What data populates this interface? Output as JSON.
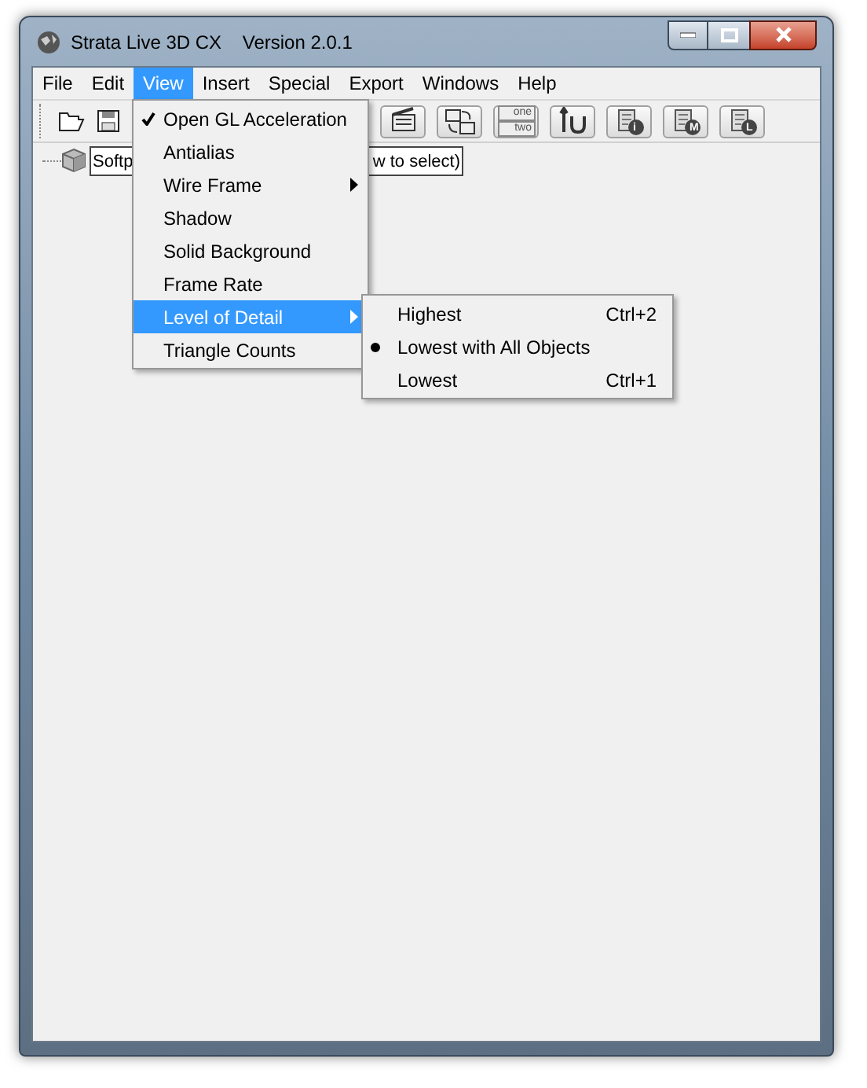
{
  "window": {
    "title": "Strata Live 3D CX    Version 2.0.1"
  },
  "menu_bar": [
    {
      "label": "File",
      "selected": false
    },
    {
      "label": "Edit",
      "selected": false
    },
    {
      "label": "View",
      "selected": true
    },
    {
      "label": "Insert",
      "selected": false
    },
    {
      "label": "Special",
      "selected": false
    },
    {
      "label": "Export",
      "selected": false
    },
    {
      "label": "Windows",
      "selected": false
    },
    {
      "label": "Help",
      "selected": false
    }
  ],
  "toolbar": {
    "buttons": [
      {
        "kind": "clapper"
      },
      {
        "kind": "clappers"
      },
      {
        "kind": "onetwo",
        "texts": [
          "one",
          "two"
        ]
      },
      {
        "kind": "loop"
      },
      {
        "kind": "doc-i",
        "letter": "i"
      },
      {
        "kind": "doc-m",
        "letter": "M"
      },
      {
        "kind": "doc-l",
        "letter": "L"
      }
    ]
  },
  "tree": {
    "label_start": "Softp",
    "label_end": "w to select)"
  },
  "view_menu": [
    {
      "label": "Open GL Acceleration",
      "checked": true,
      "submenu": false,
      "selected": false
    },
    {
      "label": "Antialias",
      "checked": false,
      "submenu": false,
      "selected": false
    },
    {
      "label": "Wire Frame",
      "checked": false,
      "submenu": true,
      "selected": false
    },
    {
      "label": "Shadow",
      "checked": false,
      "submenu": false,
      "selected": false
    },
    {
      "label": "Solid Background",
      "checked": false,
      "submenu": false,
      "selected": false
    },
    {
      "label": "Frame Rate",
      "checked": false,
      "submenu": false,
      "selected": false
    },
    {
      "label": "Level of Detail",
      "checked": false,
      "submenu": true,
      "selected": true
    },
    {
      "label": "Triangle Counts",
      "checked": false,
      "submenu": false,
      "selected": false
    }
  ],
  "detail_submenu": [
    {
      "label": "Highest",
      "shortcut": "Ctrl+2",
      "selected": false
    },
    {
      "label": "Lowest with All Objects",
      "selected": true
    },
    {
      "label": "Lowest",
      "shortcut": "Ctrl+1",
      "selected": false
    }
  ]
}
